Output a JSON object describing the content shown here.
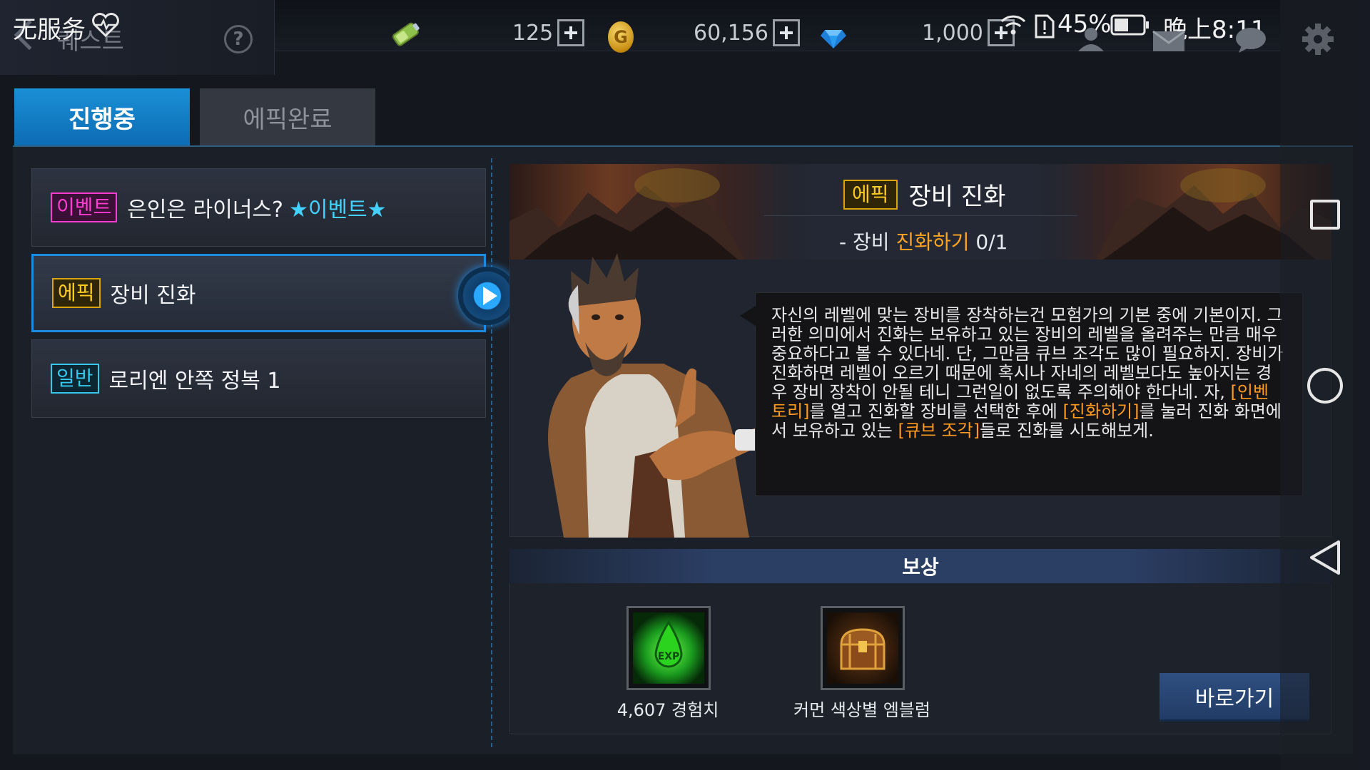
{
  "status_bar": {
    "carrier": "无服务",
    "battery_percent": "45%",
    "time": "晚上8:11"
  },
  "header": {
    "title": "퀘스트",
    "stamina_value": "125",
    "gold_value": "60,156",
    "gem_value": "1,000",
    "coin_letter": "G"
  },
  "tabs": [
    {
      "label": "진행중",
      "active": true
    },
    {
      "label": "에픽완료",
      "active": false
    }
  ],
  "quests": [
    {
      "badge": "이벤트",
      "badge_type": "event",
      "title": "은인은 라이너스?",
      "highlight": "★이벤트★"
    },
    {
      "badge": "에픽",
      "badge_type": "epic",
      "title": "장비 진화",
      "highlight": "",
      "selected": true
    },
    {
      "badge": "일반",
      "badge_type": "normal",
      "title": "로리엔 안쪽 정복 1",
      "highlight": ""
    }
  ],
  "detail": {
    "badge": "에픽",
    "title": "장비 진화",
    "objective_prefix": "- 장비 ",
    "objective_highlight": "진화하기",
    "objective_progress": "0/1",
    "dialogue": [
      {
        "t": "자신의 레벨에 맞는 장비를 장착하는건 모험가의 기본 중에 기본이지. 그러한 의미에서 진화는 보유하고 있는 장비의 레벨을 올려주는 만큼 매우 중요하다고 볼 수 있다네. 단, 그만큼 큐브 조각도 많이 필요하지. 장비가 진화하면 레벨이 오르기 때문에 혹시나 자네의 레벨보다도 높아지는 경우 장비 장착이 안될 테니 그런일이 없도록 주의해야 한다네. 자, "
      },
      {
        "h": "[인벤토리]"
      },
      {
        "t": "를 열고 진화할 장비를 선택한 후에 "
      },
      {
        "h": "[진화하기]"
      },
      {
        "t": "를 눌러 진화 화면에서 보유하고 있는 "
      },
      {
        "h": "[큐브 조각]"
      },
      {
        "t": "들로 진화를 시도해보게."
      }
    ]
  },
  "reward": {
    "header": "보상",
    "items": [
      {
        "label": "4,607 경험치",
        "icon": "exp-drop-icon"
      },
      {
        "label": "커먼 색상별 엠블럼",
        "icon": "treasure-chest-icon"
      }
    ],
    "go_button": "바로가기"
  },
  "colors": {
    "accent": "#1a8fd6",
    "event": "#ff3cd2",
    "epic": "#ffcc1f",
    "normal": "#36c8ef",
    "highlight": "#ff9a1f"
  }
}
